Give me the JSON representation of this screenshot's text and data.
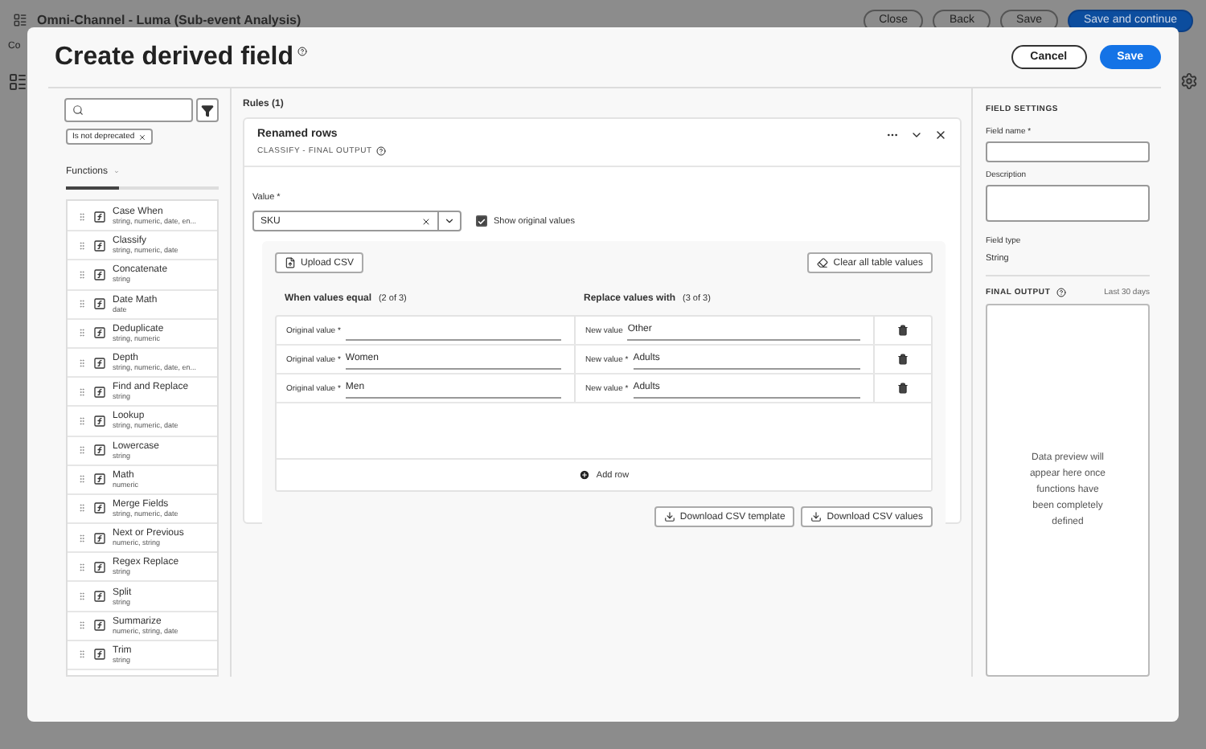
{
  "app": {
    "breadcrumb": "Omni-Channel - Luma (Sub-event Analysis)",
    "subtitle": "Co",
    "buttons": [
      {
        "label": "Close",
        "kind": "secondary"
      },
      {
        "label": "Back",
        "kind": "secondary"
      },
      {
        "label": "Save",
        "kind": "secondary"
      },
      {
        "label": "Save and continue",
        "kind": "primary"
      }
    ]
  },
  "dialog": {
    "title": "Create derived field",
    "actions": [
      {
        "label": "Cancel",
        "kind": "secondary"
      },
      {
        "label": "Save",
        "kind": "primary"
      }
    ],
    "filter_tags": [
      {
        "label": "Is not deprecated"
      }
    ],
    "functions_tab": {
      "label": "Functions",
      "selected": true
    },
    "functions": [
      {
        "name": "Case When",
        "types": "string, numeric, date, en..."
      },
      {
        "name": "Classify",
        "types": "string, numeric, date"
      },
      {
        "name": "Concatenate",
        "types": "string"
      },
      {
        "name": "Date Math",
        "types": "date"
      },
      {
        "name": "Deduplicate",
        "types": "string, numeric"
      },
      {
        "name": "Depth",
        "types": "string, numeric, date, en..."
      },
      {
        "name": "Find and Replace",
        "types": "string"
      },
      {
        "name": "Lookup",
        "types": "string, numeric, date"
      },
      {
        "name": "Lowercase",
        "types": "string"
      },
      {
        "name": "Math",
        "types": "numeric"
      },
      {
        "name": "Merge Fields",
        "types": "string, numeric, date"
      },
      {
        "name": "Next or Previous",
        "types": "numeric, string"
      },
      {
        "name": "Regex Replace",
        "types": "string"
      },
      {
        "name": "Split",
        "types": "string"
      },
      {
        "name": "Summarize",
        "types": "numeric, string, date"
      },
      {
        "name": "Trim",
        "types": "string"
      }
    ],
    "rules_heading": "Rules (1)",
    "rule": {
      "title": "Renamed rows",
      "subtitle": "CLASSIFY - FINAL OUTPUT",
      "value_label": "Value *",
      "value": "SKU",
      "show_original": {
        "label": "Show original values",
        "checked": true
      },
      "upload_label": "Upload CSV",
      "clear_label": "Clear all table values",
      "left_header": "When values equal",
      "left_count": "(2 of 3)",
      "right_header": "Replace values with",
      "right_count": "(3 of 3)",
      "rows": [
        {
          "original_label": "Original value *",
          "original_value": "",
          "new_label": "New value",
          "new_value": "Other"
        },
        {
          "original_label": "Original value *",
          "original_value": "Women",
          "new_label": "New value *",
          "new_value": "Adults"
        },
        {
          "original_label": "Original value *",
          "original_value": "Men",
          "new_label": "New value *",
          "new_value": "Adults"
        }
      ],
      "add_row": "Add row",
      "downloads": [
        "Download CSV template",
        "Download CSV values"
      ]
    },
    "settings": {
      "heading": "FIELD SETTINGS",
      "field_name_label": "Field name *",
      "description_label": "Description",
      "field_type_label": "Field type",
      "field_type": "String",
      "final_output_heading": "FINAL OUTPUT",
      "range": "Last 30 days",
      "preview_message": "Data preview will appear here once functions have been completely defined"
    }
  }
}
